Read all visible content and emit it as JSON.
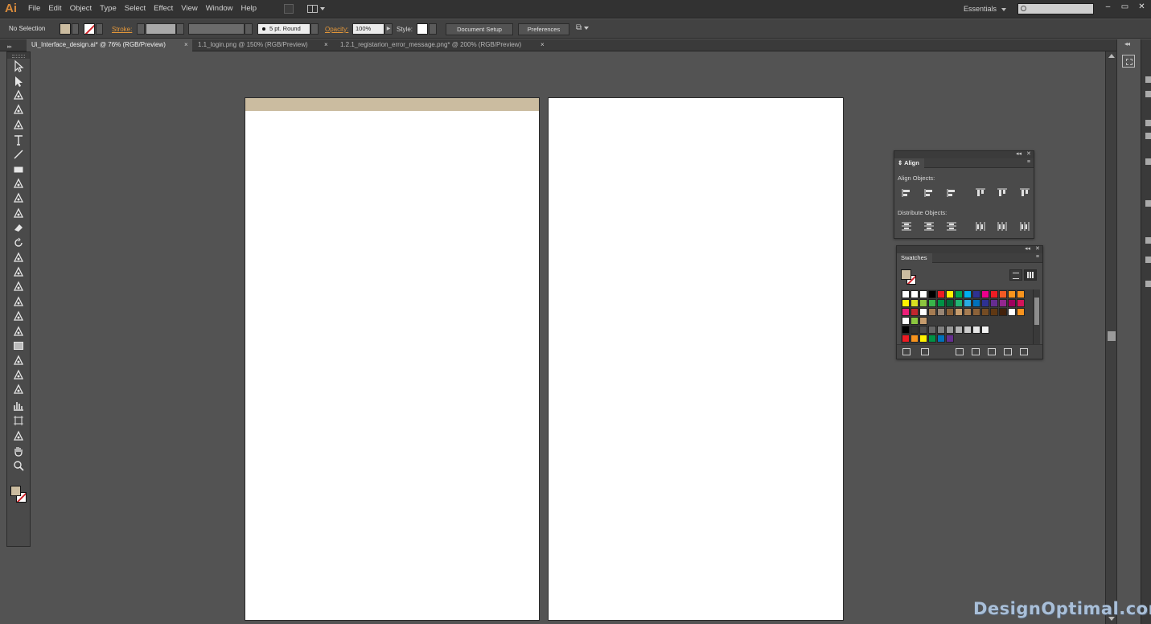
{
  "app": {
    "logo": "Ai"
  },
  "menu": [
    "File",
    "Edit",
    "Object",
    "Type",
    "Select",
    "Effect",
    "View",
    "Window",
    "Help"
  ],
  "workspace": {
    "label": "Essentials"
  },
  "search": {
    "placeholder": ""
  },
  "window_controls": {
    "minimize": "–",
    "restore": "▭",
    "close": "✕"
  },
  "control_bar": {
    "selection_state": "No Selection",
    "stroke_label": "Stroke:",
    "brush_value": "5 pt. Round",
    "opacity_label": "Opacity:",
    "opacity_value": "100%",
    "style_label": "Style:",
    "document_setup": "Document Setup",
    "preferences": "Preferences"
  },
  "tabs": [
    {
      "title": "Ui_Interface_design.ai* @ 76% (RGB/Preview)",
      "close": "×",
      "active": true
    },
    {
      "title": "1.1_login.png @ 150% (RGB/Preview)",
      "close": "×",
      "active": false
    },
    {
      "title": "1.2.1_registarion_error_message.png* @ 200% (RGB/Preview)",
      "close": "×",
      "active": false
    }
  ],
  "tools": [
    "selection-tool",
    "direct-selection-tool",
    "magic-wand-tool",
    "lasso-tool",
    "pen-tool",
    "type-tool",
    "line-segment-tool",
    "rectangle-tool",
    "paintbrush-tool",
    "pencil-tool",
    "blob-brush-tool",
    "eraser-tool",
    "rotate-tool",
    "scale-tool",
    "width-tool",
    "free-transform-tool",
    "shape-builder-tool",
    "perspective-grid-tool",
    "mesh-tool",
    "gradient-tool",
    "eyedropper-tool",
    "blend-tool",
    "symbol-sprayer-tool",
    "column-graph-tool",
    "artboard-tool",
    "slice-tool",
    "hand-tool",
    "zoom-tool"
  ],
  "colors": {
    "fill": "#cbbca0",
    "canvas": "#535353",
    "accent_label": "#e3973a",
    "header_strip": "#cbbca0"
  },
  "align_panel": {
    "title": "Align",
    "collapse": "◂◂",
    "close": "✕",
    "menu": "≡",
    "align_objects_label": "Align Objects:",
    "distribute_objects_label": "Distribute Objects:",
    "align_buttons": [
      "horizontal-align-left",
      "horizontal-align-center",
      "horizontal-align-right",
      "vertical-align-top",
      "vertical-align-center",
      "vertical-align-bottom"
    ],
    "distribute_buttons": [
      "vertical-distribute-top",
      "vertical-distribute-center",
      "vertical-distribute-bottom",
      "horizontal-distribute-left",
      "horizontal-distribute-center",
      "horizontal-distribute-right"
    ]
  },
  "swatches_panel": {
    "title": "Swatches",
    "collapse": "◂◂",
    "close": "✕",
    "menu": "≡",
    "rows": [
      [
        "#ffffff",
        "#ffffff",
        "#ffffff",
        "#000000",
        "#ed1c24",
        "#fff200",
        "#00a651",
        "#00aeef",
        "#2e3192",
        "#ec008c",
        "#ed1c24",
        "#f15a24",
        "#f7941d",
        "#f7941d"
      ],
      [
        "#fff200",
        "#d9e021",
        "#8cc63f",
        "#39b54a",
        "#009245",
        "#006837",
        "#22b573",
        "#29abe2",
        "#0071bc",
        "#2e3192",
        "#662d91",
        "#93278f",
        "#9e005d",
        "#d4145a"
      ],
      [
        "#ed1e79",
        "#c1272d",
        "#ffffff",
        "#a67c52",
        "#998675",
        "#8c6239",
        "#c69c6d",
        "#a67c52",
        "#8c6239",
        "#754c24",
        "#603813",
        "#42210b",
        "#ffffff",
        "#f7931e"
      ],
      [
        "#ffffff",
        "#8cc63f",
        "#c69c6d"
      ],
      [
        "#000000",
        "#333333",
        "#4d4d4d",
        "#666666",
        "#808080",
        "#999999",
        "#b3b3b3",
        "#cccccc",
        "#e6e6e6",
        "#f2f2f2"
      ],
      [
        "#ed1c24",
        "#f7931e",
        "#fff200",
        "#009245",
        "#0071bc",
        "#662d91"
      ]
    ]
  },
  "watermark": "DesignOptimal.com"
}
